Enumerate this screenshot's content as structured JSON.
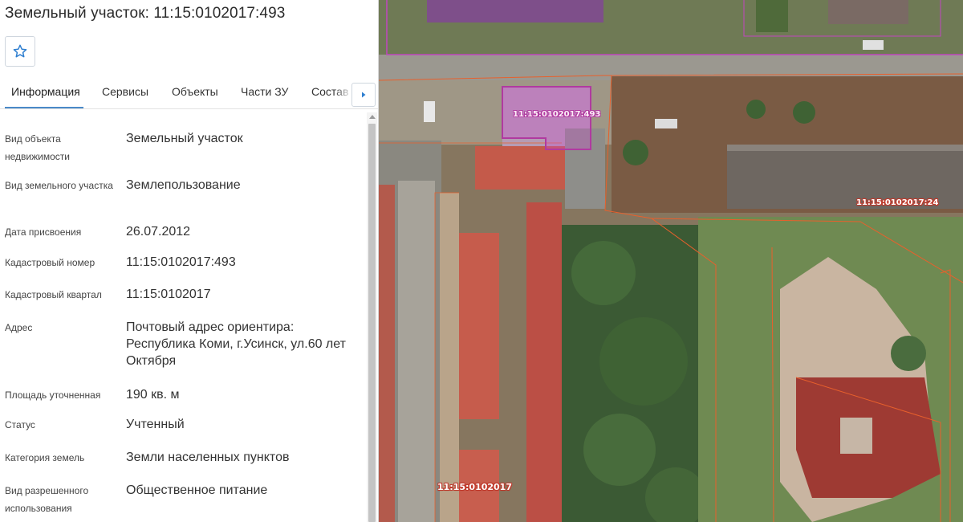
{
  "header": {
    "title": "Земельный участок: 11:15:0102017:493",
    "favorite_icon": "star-icon"
  },
  "tabs": [
    {
      "label": "Информация",
      "active": true
    },
    {
      "label": "Сервисы",
      "active": false
    },
    {
      "label": "Объекты",
      "active": false
    },
    {
      "label": "Части ЗУ",
      "active": false
    },
    {
      "label": "Состав",
      "active": false
    }
  ],
  "tabs_next_icon": "chevron-right-icon",
  "properties": [
    {
      "label": "Вид объекта недвижимости",
      "value": "Земельный участок"
    },
    {
      "label": "Вид земельного участка",
      "value": "Землепользование"
    },
    {
      "label": "Дата присвоения",
      "value": "26.07.2012"
    },
    {
      "label": "Кадастровый номер",
      "value": "11:15:0102017:493"
    },
    {
      "label": "Кадастровый квартал",
      "value": "11:15:0102017"
    },
    {
      "label": "Адрес",
      "value": "Почтовый адрес ориентира: Республика Коми, г.Усинск, ул.60 лет Октября"
    },
    {
      "label": "Площадь уточненная",
      "value": "190 кв. м"
    },
    {
      "label": "Статус",
      "value": "Учтенный"
    },
    {
      "label": "Категория земель",
      "value": "Земли населенных пунктов"
    },
    {
      "label": "Вид разрешенного использования",
      "value": "Общественное питание"
    }
  ],
  "map": {
    "labels": [
      {
        "text": "11:15:0102017:493"
      },
      {
        "text": "11:15:0102017:24"
      },
      {
        "text": "11:15:0102017"
      }
    ],
    "colors": {
      "selected_parcel": "#b03aa0",
      "parcel_border": "#e8602c",
      "accent": "#4a89c8"
    }
  }
}
